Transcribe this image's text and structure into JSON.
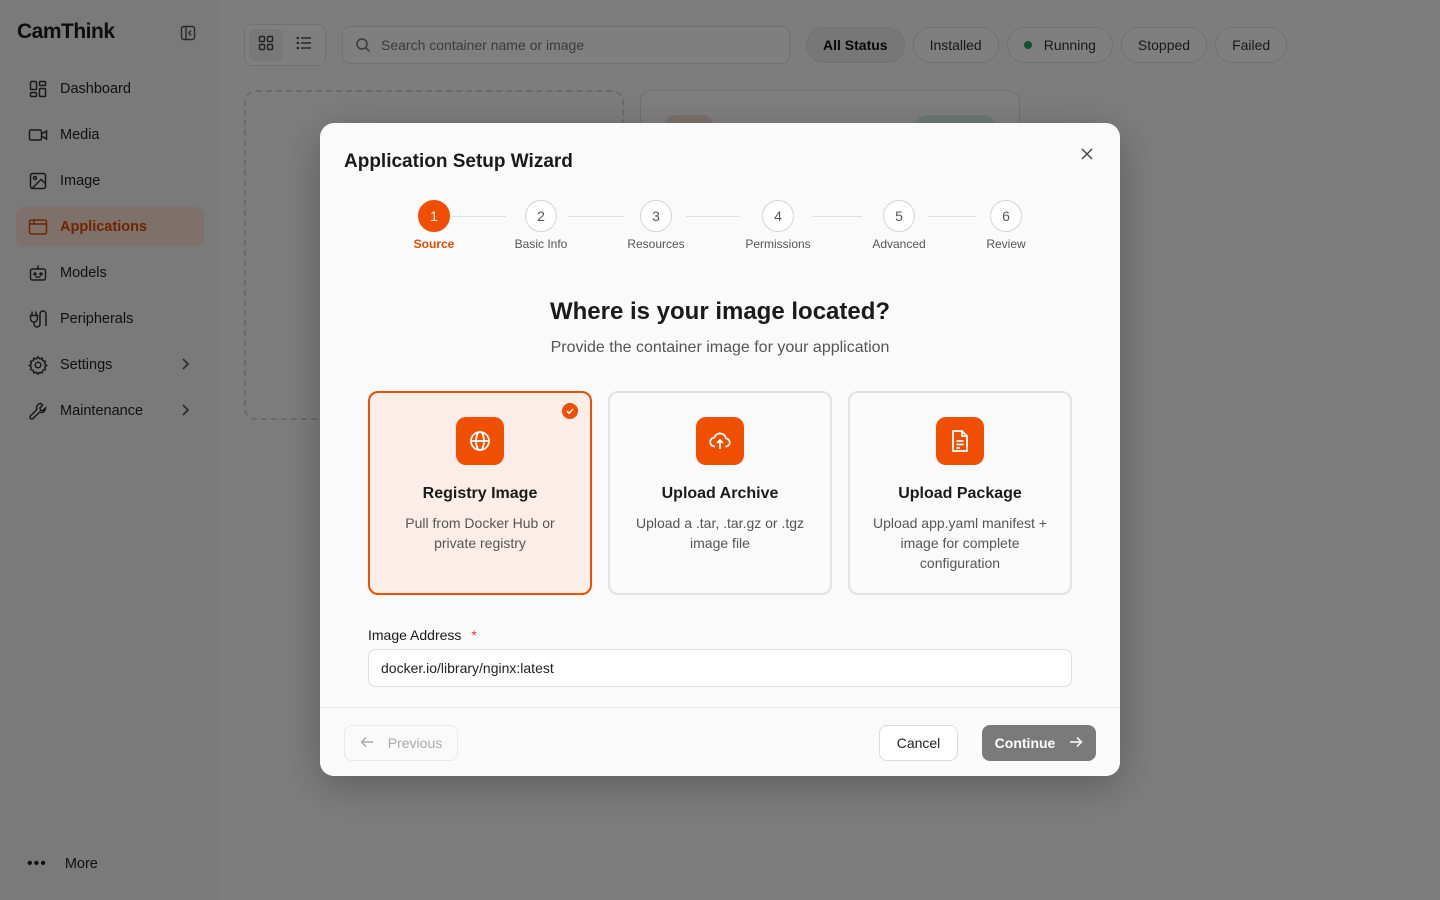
{
  "app": {
    "brand": "CamThink",
    "accent_color": "#f04e00"
  },
  "sidebar": {
    "items": [
      {
        "label": "Dashboard",
        "icon": "dashboard-icon"
      },
      {
        "label": "Media",
        "icon": "video-camera-icon"
      },
      {
        "label": "Image",
        "icon": "image-icon"
      },
      {
        "label": "Applications",
        "icon": "applications-icon",
        "active": true
      },
      {
        "label": "Models",
        "icon": "robot-icon"
      },
      {
        "label": "Peripherals",
        "icon": "peripherals-icon"
      },
      {
        "label": "Settings",
        "icon": "gear-icon",
        "expandable": true
      },
      {
        "label": "Maintenance",
        "icon": "wrench-icon",
        "expandable": true
      }
    ],
    "more_label": "More"
  },
  "toolbar": {
    "search_placeholder": "Search container name or image",
    "filters": [
      "All Status",
      "Installed",
      "Running",
      "Stopped",
      "Failed"
    ],
    "selected_filter": "All Status"
  },
  "wizard": {
    "title": "Application Setup Wizard",
    "steps": [
      {
        "number": "1",
        "label": "Source"
      },
      {
        "number": "2",
        "label": "Basic Info"
      },
      {
        "number": "3",
        "label": "Resources"
      },
      {
        "number": "4",
        "label": "Permissions"
      },
      {
        "number": "5",
        "label": "Advanced"
      },
      {
        "number": "6",
        "label": "Review"
      }
    ],
    "current_step": 1,
    "heading": "Where is your image located?",
    "subheading": "Provide the container image for your application",
    "options": [
      {
        "title": "Registry Image",
        "description": "Pull from Docker Hub or private registry",
        "icon": "globe-icon",
        "selected": true
      },
      {
        "title": "Upload Archive",
        "description": "Upload a .tar, .tar.gz or .tgz image file",
        "icon": "cloud-upload-icon",
        "selected": false
      },
      {
        "title": "Upload Package",
        "description": "Upload app.yaml manifest + image for complete configuration",
        "icon": "document-icon",
        "selected": false
      }
    ],
    "image_address": {
      "label": "Image Address",
      "required_mark": "*",
      "value": "docker.io/library/nginx:latest"
    },
    "buttons": {
      "previous": "Previous",
      "cancel": "Cancel",
      "continue": "Continue"
    }
  }
}
